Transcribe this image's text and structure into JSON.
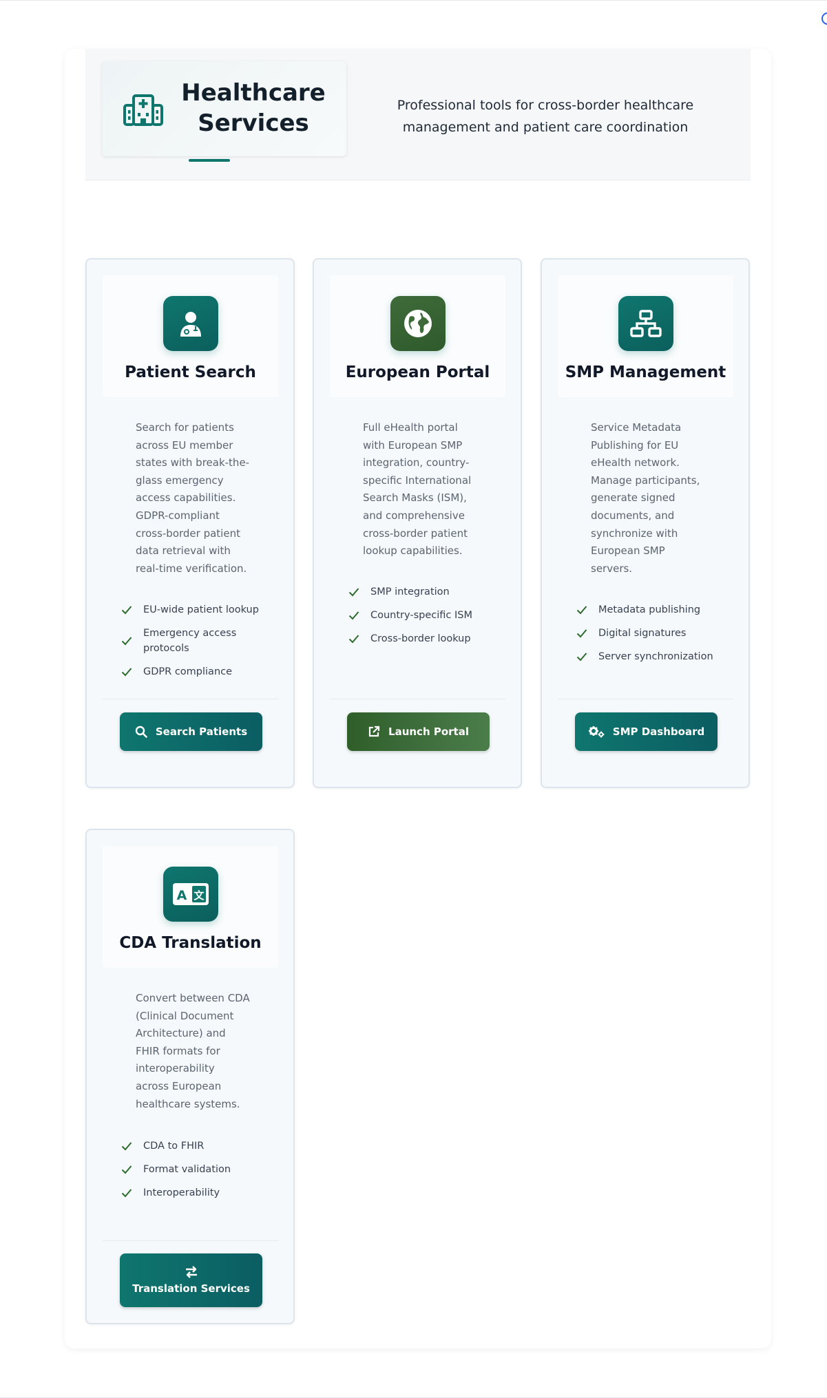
{
  "header": {
    "title": "Healthcare Services",
    "subtitle": "Professional tools for cross-border healthcare management and patient care coordination",
    "icon": "hospital-icon"
  },
  "services": [
    {
      "title": "Patient Search",
      "icon": "user-doctor-icon",
      "description": "Search for patients across EU member states with break-the-glass emergency access capabilities. GDPR-compliant cross-border patient data retrieval with real-time verification.",
      "features": [
        "EU-wide patient lookup",
        "Emergency access protocols",
        "GDPR compliance"
      ],
      "button": {
        "label": "Search Patients",
        "icon": "search-icon"
      }
    },
    {
      "title": "European Portal",
      "icon": "globe-europe-icon",
      "description": "Full eHealth portal with European SMP integration, country-specific International Search Masks (ISM), and comprehensive cross-border patient lookup capabilities.",
      "features": [
        "SMP integration",
        "Country-specific ISM",
        "Cross-border lookup"
      ],
      "button": {
        "label": "Launch Portal",
        "icon": "external-link-icon"
      }
    },
    {
      "title": "SMP Management",
      "icon": "network-icon",
      "description": "Service Metadata Publishing for EU eHealth network. Manage participants, generate signed documents, and synchronize with European SMP servers.",
      "features": [
        "Metadata publishing",
        "Digital signatures",
        "Server synchronization"
      ],
      "button": {
        "label": "SMP Dashboard",
        "icon": "cogs-icon"
      }
    },
    {
      "title": "CDA Translation",
      "icon": "language-icon",
      "description": "Convert between CDA (Clinical Document Architecture) and FHIR formats for interoperability across European healthcare systems.",
      "features": [
        "CDA to FHIR",
        "Format validation",
        "Interoperability"
      ],
      "button": {
        "label": "Translation Services",
        "icon": "exchange-icon"
      }
    }
  ],
  "colors": {
    "primary_teal": "#0f766e",
    "portal_green": "#3f6b3a",
    "check_green": "#2e6b2e",
    "heading": "#111827"
  }
}
